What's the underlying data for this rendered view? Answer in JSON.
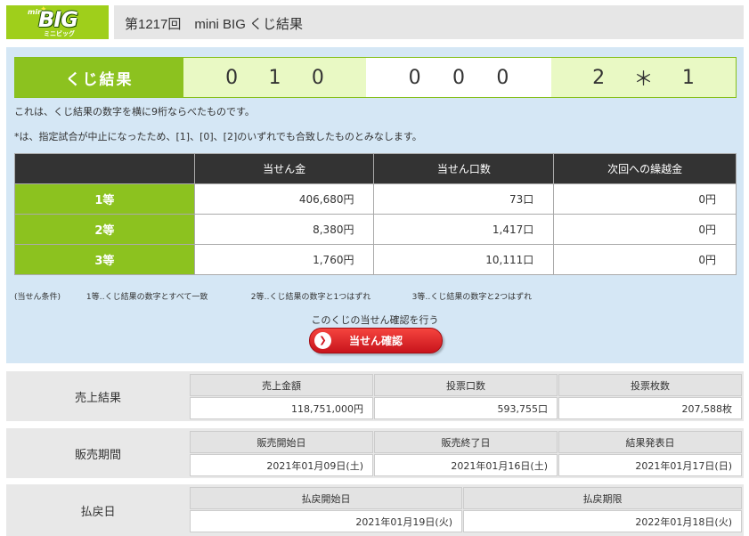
{
  "header": {
    "logo_mini": "mini",
    "logo_big": "BIG",
    "logo_sub": "ミニビッグ",
    "title": "第1217回　mini BIG くじ結果"
  },
  "result": {
    "label": "くじ結果",
    "groups": [
      [
        "0",
        "1",
        "0"
      ],
      [
        "0",
        "0",
        "0"
      ],
      [
        "2",
        "＊",
        "1"
      ]
    ],
    "note1": "これは、くじ結果の数字を横に9桁ならべたものです。",
    "note2": "*は、指定試合が中止になったため、[1]、[0]、[2]のいずれでも合致したものとみなします。"
  },
  "prize_table": {
    "headers": [
      "",
      "当せん金",
      "当せん口数",
      "次回への繰越金"
    ],
    "rows": [
      {
        "grade": "1等",
        "amount": "406,680円",
        "count": "73口",
        "carryover": "0円"
      },
      {
        "grade": "2等",
        "amount": "8,380円",
        "count": "1,417口",
        "carryover": "0円"
      },
      {
        "grade": "3等",
        "amount": "1,760円",
        "count": "10,111口",
        "carryover": "0円"
      }
    ]
  },
  "conditions": {
    "label": "(当せん条件)",
    "c1": "1等‥くじ結果の数字とすべて一致",
    "c2": "2等‥くじ結果の数字と1つはずれ",
    "c3": "3等‥くじ結果の数字と2つはずれ"
  },
  "confirm": {
    "text": "このくじの当せん確認を行う",
    "button": "当せん確認"
  },
  "sales": {
    "label": "売上結果",
    "headers": [
      "売上金額",
      "投票口数",
      "投票枚数"
    ],
    "values": [
      "118,751,000円",
      "593,755口",
      "207,588枚"
    ]
  },
  "period": {
    "label": "販売期間",
    "headers": [
      "販売開始日",
      "販売終了日",
      "結果発表日"
    ],
    "values": [
      "2021年01月09日(土)",
      "2021年01月16日(土)",
      "2021年01月17日(日)"
    ]
  },
  "payout": {
    "label": "払戻日",
    "headers": [
      "払戻開始日",
      "払戻期限"
    ],
    "values": [
      "2021年01月19日(火)",
      "2022年01月18日(火)"
    ]
  },
  "colors": {
    "accent_green": "#8cc21f",
    "light_green": "#e9f9c4",
    "panel_blue": "#d5e7f5",
    "button_red": "#d0141d"
  }
}
